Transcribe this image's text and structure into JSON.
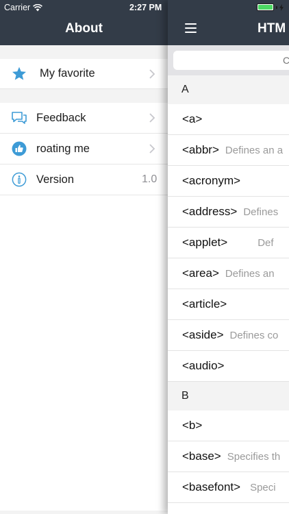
{
  "status_bar": {
    "carrier": "Carrier",
    "time": "2:27 PM",
    "wifi_icon": "wifi-icon",
    "battery_icon": "battery-icon",
    "charging_icon": "bolt-icon",
    "battery_level": 1.0
  },
  "menu": {
    "title": "About",
    "favorite": {
      "label": "My favorite",
      "icon": "star-icon"
    },
    "items": [
      {
        "label": "Feedback",
        "icon": "chat-bubbles-icon"
      },
      {
        "label": "roating me",
        "icon": "thumbs-up-icon"
      },
      {
        "label": "Version",
        "icon": "info-icon",
        "value": "1.0"
      }
    ]
  },
  "content": {
    "title": "HTM",
    "menu_icon": "hamburger-icon",
    "search": {
      "placeholder": "C"
    },
    "sections": [
      {
        "letter": "A",
        "tags": [
          {
            "name": "<a>",
            "desc": ""
          },
          {
            "name": "<abbr>",
            "desc": "Defines an a"
          },
          {
            "name": "<acronym>",
            "desc": ""
          },
          {
            "name": "<address>",
            "desc": "Defines"
          },
          {
            "name": "<applet>",
            "desc": "Def"
          },
          {
            "name": "<area>",
            "desc": "Defines an"
          },
          {
            "name": "<article>",
            "desc": ""
          },
          {
            "name": "<aside>",
            "desc": "Defines co"
          },
          {
            "name": "<audio>",
            "desc": ""
          }
        ]
      },
      {
        "letter": "B",
        "tags": [
          {
            "name": "<b>",
            "desc": ""
          },
          {
            "name": "<base>",
            "desc": "Specifies th"
          },
          {
            "name": "<basefont>",
            "desc": "Speci"
          }
        ]
      }
    ]
  },
  "colors": {
    "nav_bar": "#333c48",
    "accent_blue": "#3d9bd6",
    "battery_green": "#4cd964"
  }
}
